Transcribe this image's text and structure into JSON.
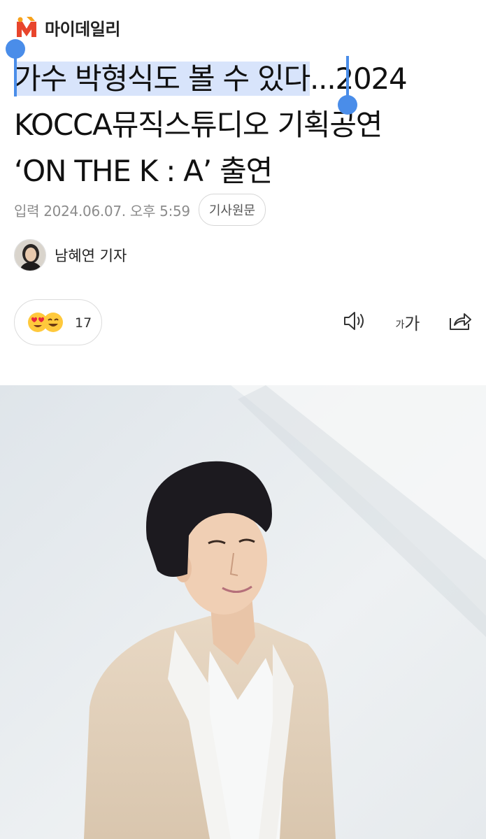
{
  "publisher": {
    "name": "마이데일리",
    "logo_icon": "mydaily-logo-icon",
    "accent": "#e8452c"
  },
  "article": {
    "title_selected": "가수 박형식도 볼 수 있다",
    "title_rest_line1": "...2024",
    "title_line2": "KOCCA뮤직스튜디오 기획공연",
    "title_line3": "‘ON THE K : A’ 출연",
    "published": "입력 2024.06.07. 오후 5:59",
    "original_link": "기사원문"
  },
  "author": {
    "name": "남혜연 기자"
  },
  "reactions": {
    "count": "17",
    "icons": [
      "heart-eyes-emoji-icon",
      "grin-emoji-icon"
    ]
  },
  "toolbar": {
    "tts_icon": "speaker-icon",
    "font_size_small": "가",
    "font_size_large": "가",
    "share_icon": "share-icon"
  },
  "selection": {
    "color": "#4a8de9",
    "highlight": "#d8e4fb"
  }
}
